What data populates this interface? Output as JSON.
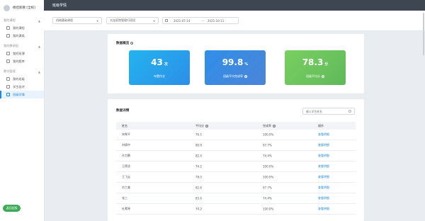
{
  "sidebar": {
    "user_name": "杨佳新教 [全校]",
    "sections": [
      {
        "title": "我的课程",
        "items": [
          {
            "label": "我的课程"
          },
          {
            "label": "我的课表"
          }
        ]
      },
      {
        "title": "我的教研组",
        "items": [
          {
            "label": "我的班课"
          },
          {
            "label": "我的题库"
          }
        ]
      },
      {
        "title": "教学管理",
        "items": [
          {
            "label": "我的班级"
          },
          {
            "label": "学生画评"
          },
          {
            "label": "班级学情"
          }
        ]
      }
    ],
    "download_label": "返回旧版"
  },
  "topbar": {
    "title": "班级学情"
  },
  "filters": {
    "course": "机械基础课程",
    "class": "大连医院管理行班班",
    "date_start": "2021-07-14",
    "date_sep": "—",
    "date_end": "2021-10-11"
  },
  "overview": {
    "title": "数据概览",
    "stats": [
      {
        "value": "43",
        "unit": "次",
        "label": "布置作业"
      },
      {
        "value": "99.8",
        "unit": "%",
        "label": "班级平均完成率"
      },
      {
        "value": "78.3",
        "unit": "分",
        "label": "班级平均分"
      }
    ]
  },
  "detail": {
    "title": "数据详情",
    "search_placeholder": "输入学生姓名",
    "columns": [
      "姓名",
      "平均分",
      "完成率",
      "操作"
    ],
    "rows": [
      {
        "name": "宋希平",
        "avg": "76.5",
        "rate": "100.0%",
        "op": "查看明细"
      },
      {
        "name": "刘倩中",
        "avg": "80.9",
        "rate": "97.7%",
        "op": "查看明细"
      },
      {
        "name": "孙力鹏",
        "avg": "82.4",
        "rate": "74.4%",
        "op": "查看明细"
      },
      {
        "name": "王德凌",
        "avg": "74.2",
        "rate": "100.0%",
        "op": "查看明细"
      },
      {
        "name": "王飞云",
        "avg": "78.0",
        "rate": "100.0%",
        "op": "查看明细"
      },
      {
        "name": "肖兰美",
        "avg": "82.6",
        "rate": "97.7%",
        "op": "查看明细"
      },
      {
        "name": "张三",
        "avg": "83.6",
        "rate": "74.4%",
        "op": "查看明细"
      },
      {
        "name": "杜素琴",
        "avg": "74.2",
        "rate": "100.0%",
        "op": "查看明细"
      }
    ]
  }
}
